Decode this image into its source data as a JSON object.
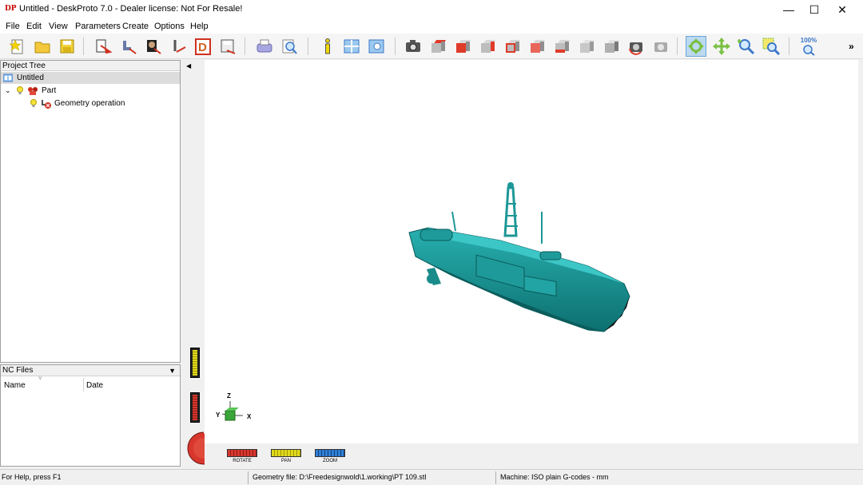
{
  "window": {
    "title": "Untitled - DeskProto 7.0 - Dealer license: Not For Resale!",
    "app_icon": "DP",
    "controls": {
      "minimize": "—",
      "maximize": "☐",
      "close": "✕"
    }
  },
  "menu": [
    "File",
    "Edit",
    "View",
    "Parameters",
    "Create",
    "Options",
    "Help"
  ],
  "toolbar": {
    "zoom_label": "100%",
    "overflow": "»",
    "icons": [
      "new-file-icon",
      "open-folder-icon",
      "save-icon",
      "wizard-icon",
      "wizard-2-icon",
      "wizard-3-icon",
      "wizard-4-icon",
      "letter-d-icon",
      "save-as-icon",
      "printer-icon",
      "print-preview-icon",
      "info-icon",
      "layout-icon",
      "view-icon",
      "camera-icon",
      "view-top-icon",
      "view-front-icon",
      "view-right-icon",
      "view-back-icon",
      "view-left-icon",
      "view-bottom-icon",
      "view-iso-icon",
      "view-iso-2-icon",
      "reset-view-icon",
      "recalculate-icon",
      "rotate-icon",
      "pan-icon",
      "zoom-icon",
      "zoom-window-icon",
      "zoom-100-icon"
    ]
  },
  "project_tree": {
    "header": "Project Tree",
    "root": "Untitled",
    "part": "Part",
    "operation": "Geometry operation"
  },
  "nc_files": {
    "header": "NC Files",
    "columns": [
      "Name",
      "Date"
    ]
  },
  "viewport": {
    "axes": {
      "z": "Z",
      "y": "Y",
      "x": "X"
    },
    "model_color": "#1f9b9b",
    "modes": [
      {
        "label": "ROTATE",
        "color": "#d8372e"
      },
      {
        "label": "PAN",
        "color": "#e0d81f"
      },
      {
        "label": "ZOOM",
        "color": "#2f7fd6"
      }
    ]
  },
  "status": {
    "help": "For Help, press F1",
    "geometry": "Geometry file: D:\\Freedesignwold\\1.working\\PT 109.stl",
    "machine": "Machine: ISO plain G-codes - mm"
  }
}
